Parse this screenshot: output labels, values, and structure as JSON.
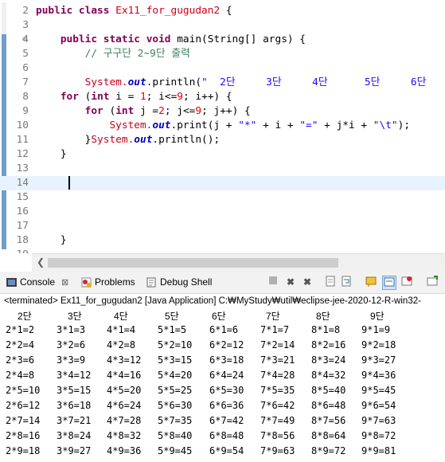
{
  "editor": {
    "lines": [
      {
        "num": "2",
        "tokens": [
          {
            "t": "public class ",
            "c": "kw"
          },
          {
            "t": "Ex11_for_gugudan2",
            "c": "cls"
          },
          {
            "t": " {",
            "c": ""
          }
        ]
      },
      {
        "num": "3",
        "tokens": []
      },
      {
        "num": "4",
        "fold": "⊖",
        "tokens": [
          {
            "t": "    ",
            "c": ""
          },
          {
            "t": "public static void ",
            "c": "kw"
          },
          {
            "t": "main(String[] args) {",
            "c": ""
          }
        ]
      },
      {
        "num": "5",
        "tokens": [
          {
            "t": "        ",
            "c": ""
          },
          {
            "t": "// 구구단 2~9단 출력",
            "c": "cmt"
          }
        ]
      },
      {
        "num": "6",
        "tokens": []
      },
      {
        "num": "7",
        "tokens": [
          {
            "t": "        ",
            "c": ""
          },
          {
            "t": "System.",
            "c": "cls"
          },
          {
            "t": "out",
            "c": "sf"
          },
          {
            "t": ".println(",
            "c": ""
          },
          {
            "t": "\"  2단     3단     4단      5단     6단",
            "c": "str"
          }
        ]
      },
      {
        "num": "8",
        "tokens": [
          {
            "t": "    ",
            "c": ""
          },
          {
            "t": "for ",
            "c": "kw"
          },
          {
            "t": "(",
            "c": ""
          },
          {
            "t": "int ",
            "c": "kw"
          },
          {
            "t": "i = ",
            "c": ""
          },
          {
            "t": "1",
            "c": "num"
          },
          {
            "t": "; i<=",
            "c": ""
          },
          {
            "t": "9",
            "c": "num"
          },
          {
            "t": "; i++) {",
            "c": ""
          }
        ]
      },
      {
        "num": "9",
        "tokens": [
          {
            "t": "        ",
            "c": ""
          },
          {
            "t": "for ",
            "c": "kw"
          },
          {
            "t": "(",
            "c": ""
          },
          {
            "t": "int ",
            "c": "kw"
          },
          {
            "t": "j =",
            "c": ""
          },
          {
            "t": "2",
            "c": "num"
          },
          {
            "t": "; j<=",
            "c": ""
          },
          {
            "t": "9",
            "c": "num"
          },
          {
            "t": "; j++) {",
            "c": ""
          }
        ]
      },
      {
        "num": "10",
        "tokens": [
          {
            "t": "            ",
            "c": ""
          },
          {
            "t": "System.",
            "c": "cls"
          },
          {
            "t": "out",
            "c": "sf"
          },
          {
            "t": ".print(j + ",
            "c": ""
          },
          {
            "t": "\"*\"",
            "c": "str"
          },
          {
            "t": " + i + ",
            "c": ""
          },
          {
            "t": "\"=\"",
            "c": "str"
          },
          {
            "t": " + j*i + ",
            "c": ""
          },
          {
            "t": "\"\\t\"",
            "c": "str"
          },
          {
            "t": ");",
            "c": ""
          }
        ]
      },
      {
        "num": "11",
        "tokens": [
          {
            "t": "        }",
            "c": ""
          },
          {
            "t": "System.",
            "c": "cls"
          },
          {
            "t": "out",
            "c": "sf"
          },
          {
            "t": ".println();",
            "c": ""
          }
        ]
      },
      {
        "num": "12",
        "tokens": [
          {
            "t": "    }",
            "c": ""
          }
        ]
      },
      {
        "num": "13",
        "tokens": []
      },
      {
        "num": "14",
        "current": true,
        "tokens": []
      },
      {
        "num": "15",
        "tokens": []
      },
      {
        "num": "16",
        "tokens": []
      },
      {
        "num": "17",
        "tokens": []
      },
      {
        "num": "18",
        "tokens": [
          {
            "t": "    }",
            "c": ""
          }
        ]
      },
      {
        "num": "19",
        "tokens": []
      }
    ]
  },
  "console": {
    "tabs": {
      "console": "Console",
      "problems": "Problems",
      "debug_shell": "Debug Shell"
    },
    "close_glyph": "⊠",
    "status": "<terminated> Ex11_for_gugudan2 [Java Application] C:₩MyStudy₩util₩eclipse-jee-2020-12-R-win32-",
    "headers": [
      "2단",
      "3단",
      "4단",
      "5단",
      "6단",
      "7단",
      "8단",
      "9단"
    ],
    "rows": [
      [
        "2*1=2",
        "3*1=3",
        "4*1=4",
        "5*1=5",
        "6*1=6",
        "7*1=7",
        "8*1=8",
        "9*1=9"
      ],
      [
        "2*2=4",
        "3*2=6",
        "4*2=8",
        "5*2=10",
        "6*2=12",
        "7*2=14",
        "8*2=16",
        "9*2=18"
      ],
      [
        "2*3=6",
        "3*3=9",
        "4*3=12",
        "5*3=15",
        "6*3=18",
        "7*3=21",
        "8*3=24",
        "9*3=27"
      ],
      [
        "2*4=8",
        "3*4=12",
        "4*4=16",
        "5*4=20",
        "6*4=24",
        "7*4=28",
        "8*4=32",
        "9*4=36"
      ],
      [
        "2*5=10",
        "3*5=15",
        "4*5=20",
        "5*5=25",
        "6*5=30",
        "7*5=35",
        "8*5=40",
        "9*5=45"
      ],
      [
        "2*6=12",
        "3*6=18",
        "4*6=24",
        "5*6=30",
        "6*6=36",
        "7*6=42",
        "8*6=48",
        "9*6=54"
      ],
      [
        "2*7=14",
        "3*7=21",
        "4*7=28",
        "5*7=35",
        "6*7=42",
        "7*7=49",
        "8*7=56",
        "9*7=63"
      ],
      [
        "2*8=16",
        "3*8=24",
        "4*8=32",
        "5*8=40",
        "6*8=48",
        "7*8=56",
        "8*8=64",
        "9*8=72"
      ],
      [
        "2*9=18",
        "3*9=27",
        "4*9=36",
        "5*9=45",
        "6*9=54",
        "7*9=63",
        "8*9=72",
        "9*9=81"
      ]
    ]
  },
  "colors": {
    "change_bar": "#6f9ec9",
    "current_line": "#e8f2fe"
  },
  "icons": [
    "console-icon",
    "problems-icon",
    "debug-shell-icon",
    "terminate-icon",
    "remove-launch-icon",
    "remove-all-icon",
    "scroll-lock-icon",
    "pin-icon",
    "display-console-icon",
    "new-console-icon",
    "word-wrap-icon",
    "open-console-icon",
    "minimize-icon"
  ]
}
